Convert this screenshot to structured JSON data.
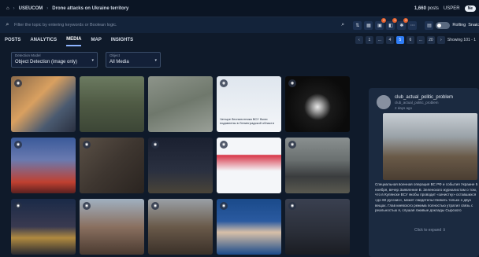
{
  "breadcrumb": {
    "home": "⌂",
    "item1": "USEUCOM",
    "item2": "Drone attacks on Ukraine territory"
  },
  "topright": {
    "count": "1,660",
    "count_label": "posts",
    "user": "USPER",
    "toggle_label": "Ne"
  },
  "search": {
    "placeholder": "Filter the topic by entering keywords or Boolean logic."
  },
  "filters": {
    "label": "Filters",
    "badges": [
      "2",
      "1",
      "2"
    ]
  },
  "timewindow": {
    "label": "Time Window",
    "rolling": "Rolling",
    "snapshot": "Snaic"
  },
  "tabs": [
    "POSTS",
    "ANALYTICS",
    "MEDIA",
    "MAP",
    "INSIGHTS"
  ],
  "pager": {
    "pages": [
      "1",
      "...",
      "4",
      "5",
      "6",
      "...",
      "20"
    ],
    "showing": "Showing 101 - 1"
  },
  "detection": {
    "label": "Detection Model",
    "value": "Object Detection (image only)"
  },
  "object": {
    "label": "Object",
    "value": "All Media"
  },
  "cards": [
    {
      "text": ""
    },
    {
      "text": ""
    },
    {
      "text": ""
    },
    {
      "text": "Четыре беспилотника ВСУ были подавлены в Ленинградской области"
    },
    {
      "text": ""
    },
    {
      "text": ""
    },
    {
      "text": ""
    },
    {
      "text": ""
    },
    {
      "text": ""
    },
    {
      "text": ""
    },
    {
      "text": ""
    },
    {
      "text": ""
    },
    {
      "text": ""
    },
    {
      "text": ""
    },
    {
      "text": ""
    }
  ],
  "post": {
    "name": "club_actual_politic_problem",
    "handle": "club_actual_politic_problem",
    "time": "2 days ago",
    "text": "Специальная военная операция ВС РФ и события Украине 5 ноября, вечер Заявление В. Зеленского журналистам о том, что в Купянске ВСУ якобы проводит «зачистку» оставшихся «до 60 русских», может свидетельствовать только о двух вещах. Глав киевского режима полностью утратил связь с реальностью я, слушая лживые доклады Сырского",
    "expand": "Click to expand"
  }
}
